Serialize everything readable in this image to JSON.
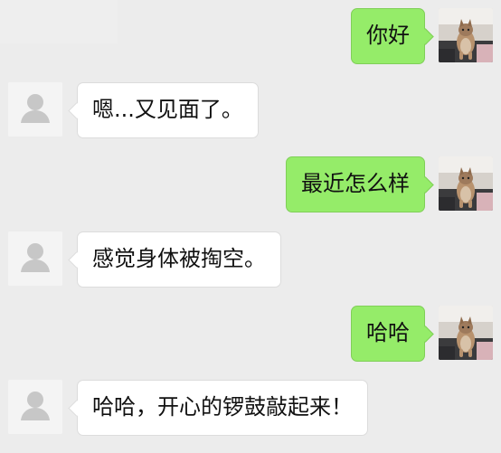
{
  "conversation": {
    "messages": [
      {
        "sender": "me",
        "text": "你好"
      },
      {
        "sender": "other",
        "text": "嗯...又见面了。"
      },
      {
        "sender": "me",
        "text": "最近怎么样"
      },
      {
        "sender": "other",
        "text": "感觉身体被掏空。"
      },
      {
        "sender": "me",
        "text": "哈哈"
      },
      {
        "sender": "other",
        "text": "哈哈，开心的锣鼓敲起来！"
      }
    ]
  },
  "icons": {
    "self_avatar": "cat-photo-avatar",
    "contact_avatar": "default-user-avatar"
  },
  "colors": {
    "background": "#ececec",
    "outgoing_bubble": "#95ec69",
    "incoming_bubble": "#ffffff"
  }
}
